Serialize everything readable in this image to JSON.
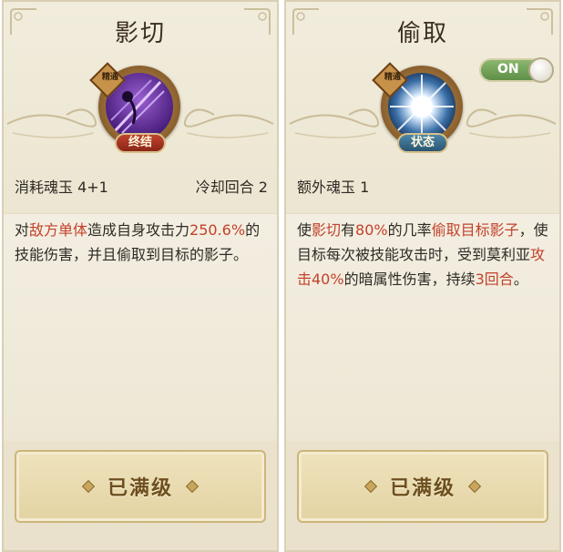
{
  "left": {
    "title": "影切",
    "badge": "终结",
    "tag": "精通",
    "cost": "消耗魂玉 4+1",
    "cooldown": "冷却回合 2",
    "desc": [
      {
        "t": "对",
        "h": false
      },
      {
        "t": "敌方单体",
        "h": true
      },
      {
        "t": "造成自身攻击力",
        "h": false
      },
      {
        "t": "250.6%",
        "h": true
      },
      {
        "t": "的技能伤害，并且偷取到目标的影子。",
        "h": false
      }
    ],
    "max_label": "已满级",
    "badge_color": "#c0432e"
  },
  "right": {
    "title": "偷取",
    "badge": "状态",
    "tag": "精通",
    "cost": "额外魂玉 1",
    "desc": [
      {
        "t": "使",
        "h": false
      },
      {
        "t": "影切",
        "h": true
      },
      {
        "t": "有",
        "h": false
      },
      {
        "t": "80%",
        "h": true
      },
      {
        "t": "的几率",
        "h": false
      },
      {
        "t": "偷取目标影子",
        "h": true
      },
      {
        "t": "，使目标每次被技能攻击时，受到莫利亚",
        "h": false
      },
      {
        "t": "攻击40%",
        "h": true
      },
      {
        "t": "的暗属性伤害，持续",
        "h": false
      },
      {
        "t": "3回合",
        "h": true
      },
      {
        "t": "。",
        "h": false
      }
    ],
    "max_label": "已满级",
    "toggle_label": "ON",
    "badge_color": "#2a5573"
  },
  "colors": {
    "highlight": "#c4412b",
    "toggle_on": "#6f9f55"
  }
}
